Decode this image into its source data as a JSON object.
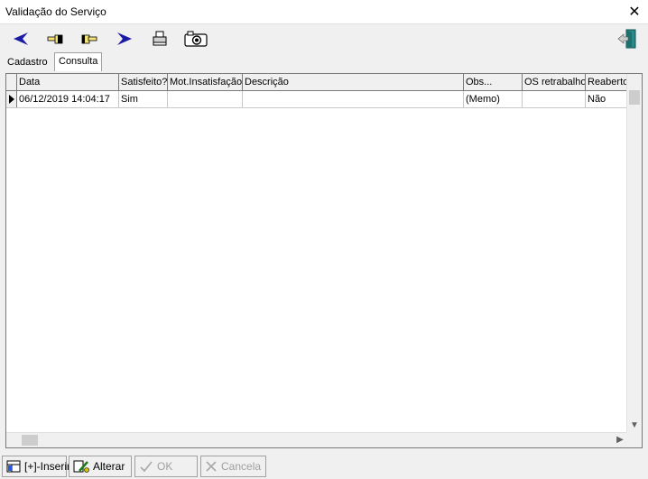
{
  "window": {
    "title": "Validação do Serviço"
  },
  "tabs": [
    {
      "label": "Cadastro",
      "active": false
    },
    {
      "label": "Consulta",
      "active": true
    }
  ],
  "grid": {
    "columns": [
      "Data",
      "Satisfeito?",
      "Mot.Insatisfação",
      "Descrição",
      "Obs...",
      "OS retrabalho",
      "Reaberto"
    ],
    "rows": [
      [
        "06/12/2019 14:04:17",
        "Sim",
        "",
        "",
        "(Memo)",
        "",
        "Não"
      ]
    ]
  },
  "buttons": {
    "inserir": "[+]-Inserir",
    "alterar": "Alterar",
    "ok": "OK",
    "cancela": "Cancela"
  },
  "colors": {
    "arrow_blue": "#1a1aa6",
    "exit_teal": "#2a8a8a"
  }
}
